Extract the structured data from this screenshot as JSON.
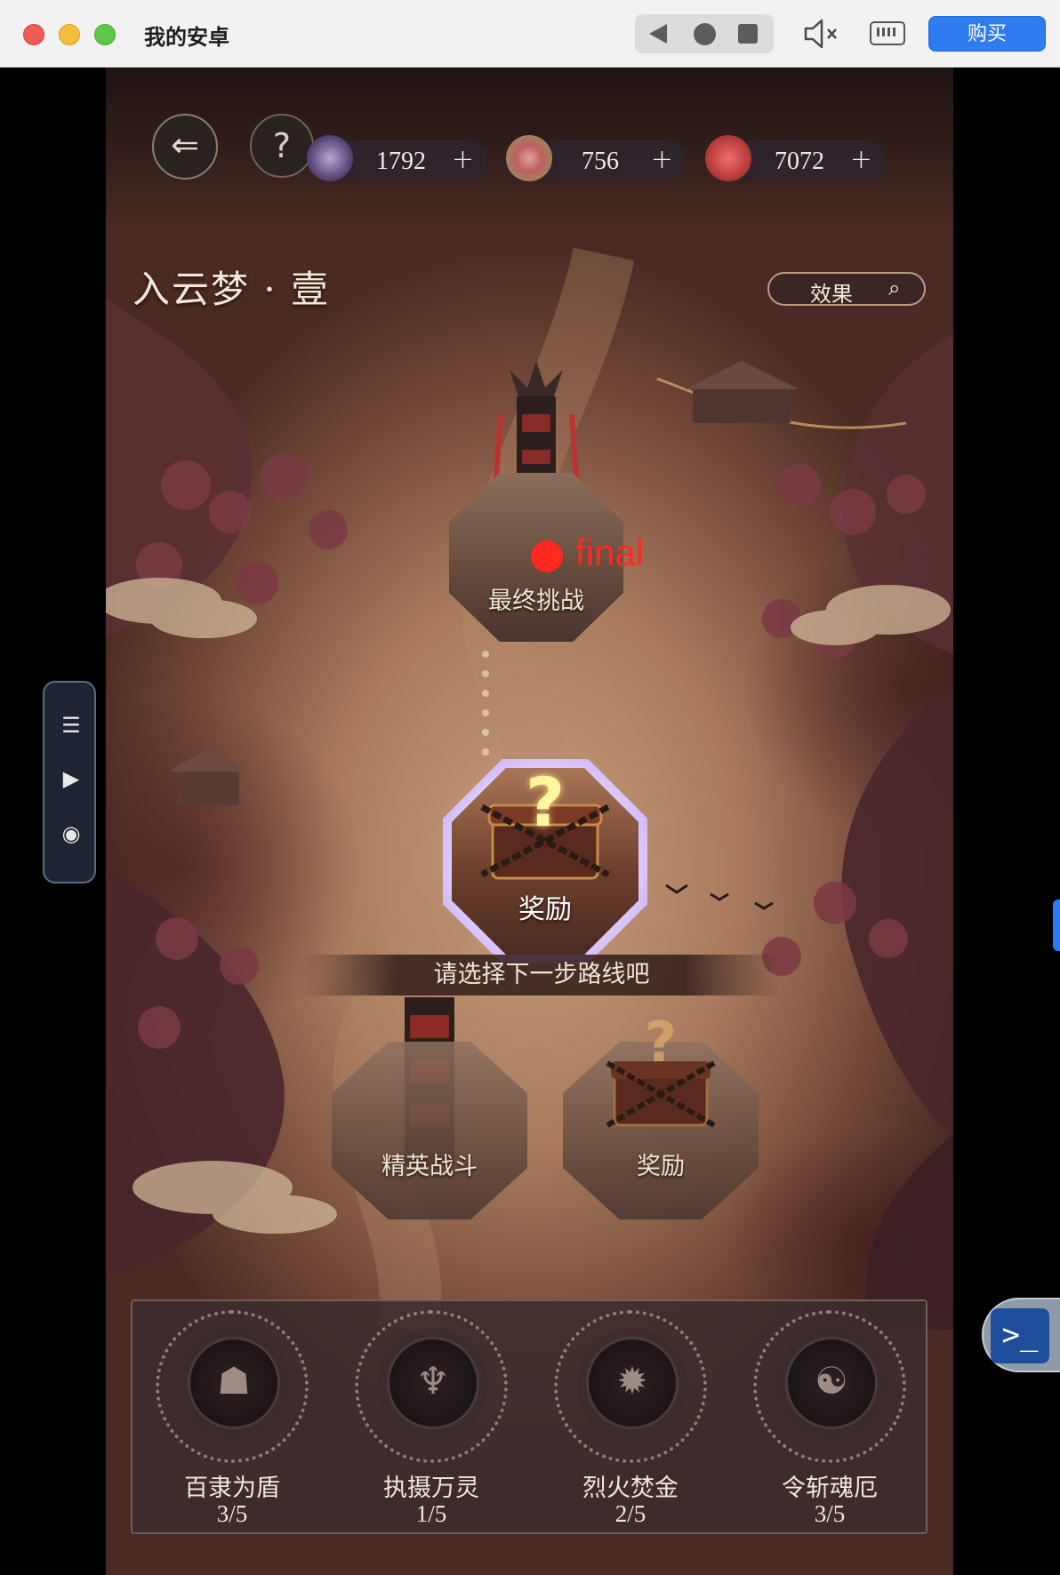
{
  "window": {
    "title": "我的安卓",
    "buy_label": "购买"
  },
  "side_toolbar": {
    "icons": [
      "list-icon",
      "play-icon",
      "record-icon"
    ]
  },
  "game": {
    "resources": [
      {
        "icon": "crystal-icon",
        "value": "1792"
      },
      {
        "icon": "treasure-box-icon",
        "value": "756"
      },
      {
        "icon": "fan-icon",
        "value": "7072"
      }
    ],
    "stage_title": "入云梦 · 壹",
    "effect_label": "效果",
    "nodes": {
      "final": {
        "label": "最终挑战"
      },
      "current": {
        "label": "奖励"
      },
      "elite": {
        "label": "精英战斗"
      },
      "reward": {
        "label": "奖励"
      }
    },
    "marker_text": "final",
    "hint": "请选择下一步路线吧",
    "skills": [
      {
        "name": "百隶为盾",
        "progress": "3/5"
      },
      {
        "name": "执摄万灵",
        "progress": "1/5"
      },
      {
        "name": "烈火焚金",
        "progress": "2/5"
      },
      {
        "name": "令斩魂厄",
        "progress": "3/5"
      }
    ]
  }
}
